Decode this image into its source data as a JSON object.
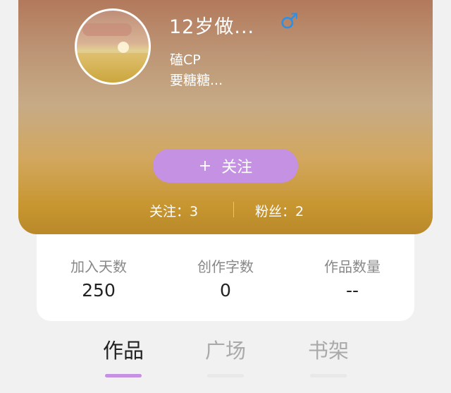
{
  "profile": {
    "username": "12岁做...",
    "gender_symbol": "♂",
    "tag1": "磕CP",
    "tag2": "要糖糖...",
    "follow_plus": "+",
    "follow_label": "关注",
    "following_text": "关注：3",
    "fans_text": "粉丝：2"
  },
  "stats": [
    {
      "label": "加入天数",
      "value": "250"
    },
    {
      "label": "创作字数",
      "value": "0"
    },
    {
      "label": "作品数量",
      "value": "--"
    }
  ],
  "tabs": [
    {
      "label": "作品"
    },
    {
      "label": "广场"
    },
    {
      "label": "书架"
    }
  ],
  "colors": {
    "accent": "#c491e3",
    "gender": "#2f8fe3"
  }
}
